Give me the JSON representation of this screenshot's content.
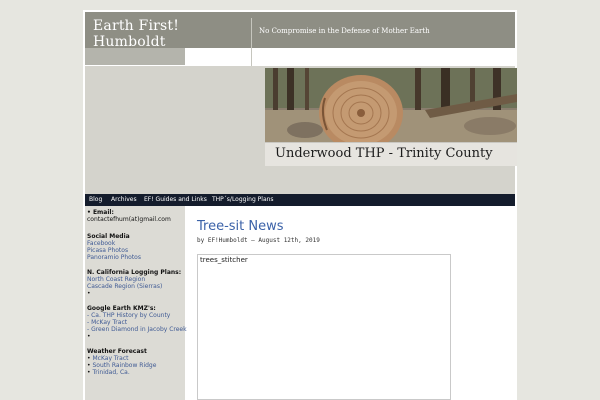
{
  "header": {
    "title": "Earth First! Humboldt",
    "tagline": "No Compromise in the Defense of Mother Earth"
  },
  "banner": {
    "caption": "Underwood THP - Trinity County"
  },
  "nav": {
    "items": [
      "Blog",
      "Archives",
      "EF! Guides and Links",
      "THP´s/Logging Plans"
    ]
  },
  "sidebar": {
    "email": {
      "heading": "Email:",
      "value": "contactefhum(at)gmail.com"
    },
    "social": {
      "heading": "Social Media",
      "links": [
        "Facebook",
        "Picasa Photos",
        "Panoramio Photos"
      ]
    },
    "logging": {
      "heading": "N. California Logging Plans:",
      "links": [
        "North Coast Region",
        "Cascade Region (Sierras)"
      ]
    },
    "kmz": {
      "heading": "Google Earth KMZ's:",
      "links": [
        "- Ca. THP History by County",
        "- McKay Tract",
        "- Green Diamond in Jacoby Creek"
      ]
    },
    "weather": {
      "heading": "Weather Forecast",
      "links": [
        "McKay Tract",
        "South Rainbow Ridge",
        "Trinidad, Ca."
      ]
    },
    "bullet": "•"
  },
  "post": {
    "title": "Tree-sit News",
    "meta": "by EF!Humboldt – August 12th, 2019",
    "media_label": "trees_stitcher"
  }
}
